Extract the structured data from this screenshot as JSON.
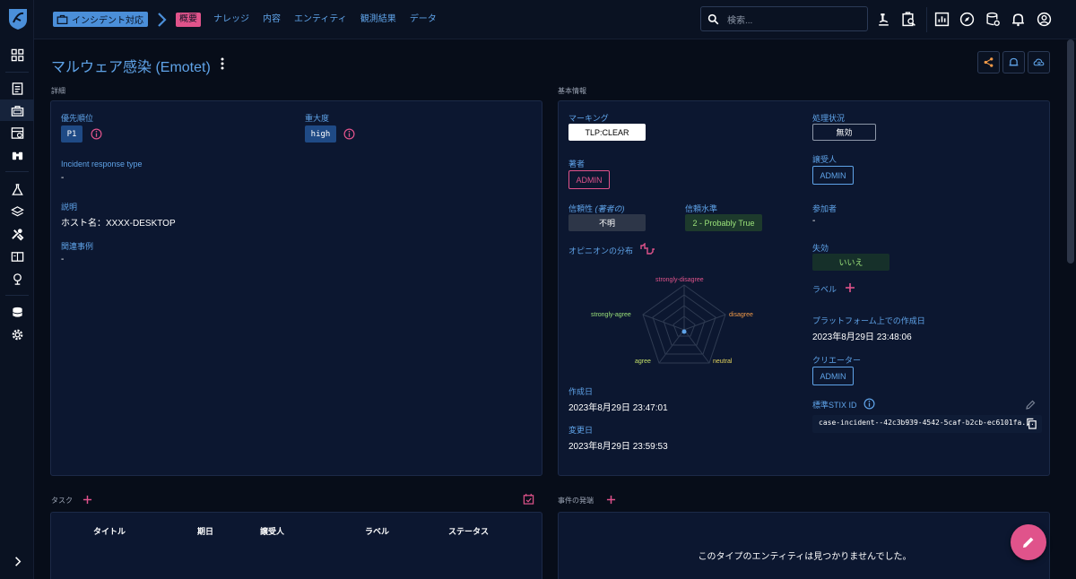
{
  "topbar": {
    "crumb": "インシデント対応",
    "tabs": [
      "概要",
      "ナレッジ",
      "内容",
      "エンティティ",
      "観測結果",
      "データ"
    ],
    "search_placeholder": "検索..."
  },
  "page": {
    "title": "マルウェア感染 (Emotet)"
  },
  "details": {
    "section": "詳細",
    "priority_label": "優先順位",
    "priority_value": "P1",
    "severity_label": "重大度",
    "severity_value": "high",
    "response_type_label": "Incident response type",
    "response_type_value": "-",
    "description_label": "説明",
    "description_value": "ホスト名：XXXX-DESKTOP",
    "related_label": "関連事例",
    "related_value": "-"
  },
  "basic": {
    "section": "基本情報",
    "marking_label": "マーキング",
    "marking_value": "TLP:CLEAR",
    "author_label": "著者",
    "author_value": "ADMIN",
    "reliability_label": "信頼性",
    "reliability_suffix": "(著者の)",
    "reliability_value": "不明",
    "confidence_label": "信頼水準",
    "confidence_value": "2 - Probably True",
    "opinion_label": "オピニオンの分布",
    "radar": {
      "strongly_disagree": "strongly-disagree",
      "disagree": "disagree",
      "neutral": "neutral",
      "agree": "agree",
      "strongly_agree": "strongly-agree"
    },
    "created_label": "作成日",
    "created_value": "2023年8月29日 23:47:01",
    "modified_label": "変更日",
    "modified_value": "2023年8月29日 23:59:53",
    "status_label": "処理状況",
    "status_value": "無効",
    "assignee_label": "譲受人",
    "assignee_value": "ADMIN",
    "participants_label": "参加者",
    "participants_value": "-",
    "revoked_label": "失効",
    "revoked_value": "いいえ",
    "labels_label": "ラベル",
    "platform_created_label": "プラットフォーム上での作成日",
    "platform_created_value": "2023年8月29日 23:48:06",
    "creator_label": "クリエーター",
    "creator_value": "ADMIN",
    "stix_label": "標準STIX ID",
    "stix_value": "case-incident--42c3b939-4542-5caf-b2cb-ec6101fa..."
  },
  "tasks": {
    "section": "タスク",
    "columns": [
      "タイトル",
      "期日",
      "譲受人",
      "ラベル",
      "ステータス"
    ]
  },
  "timeline": {
    "section": "事件の発端",
    "empty": "このタイプのエンティティは見つかりませんでした。"
  },
  "colors": {
    "accent_blue": "#5fa3e8",
    "accent_pink": "#e0538b",
    "panel": "#0c1730",
    "background": "#070d19",
    "orange": "#f29a48"
  }
}
